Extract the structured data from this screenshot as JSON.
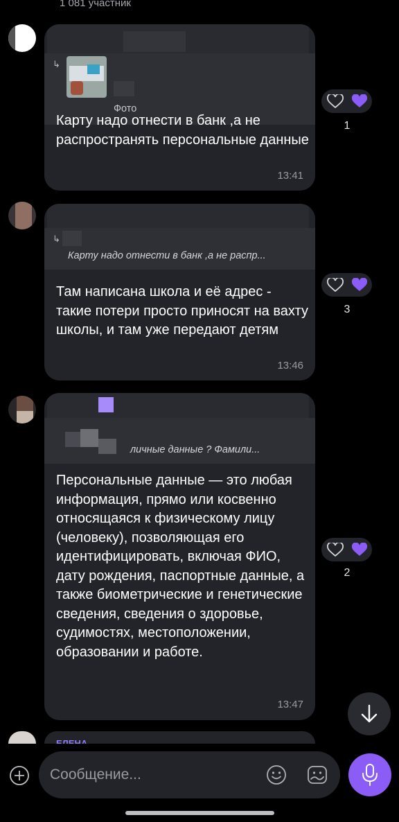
{
  "header": {
    "members": "1 081 участник"
  },
  "messages": [
    {
      "quote": {
        "label": "Фото"
      },
      "text": "Карту надо отнести в банк ,а не распространять персональные данные",
      "time": "13:41",
      "reactions": {
        "count": "1"
      }
    },
    {
      "quote": {
        "text": "Карту надо отнести в банк ,а не распр..."
      },
      "text": "Там написана школа и её адрес - такие потери просто приносят на вахту школы, и там уже передают детям",
      "time": "13:46",
      "reactions": {
        "count": "3"
      }
    },
    {
      "quote": {
        "text": "личные данные ? Фамили..."
      },
      "text": "Персональные данные — это любая информация, прямо или косвенно относящаяся к физическому лицу (человеку), позволяющая его идентифицировать, включая ФИО, дату рождения, паспортные данные, а также биометрические и генетические сведения, сведения о здоровье, судимостях, местоположении, образовании и работе.",
      "time": "13:47",
      "reactions": {
        "count": "2"
      }
    }
  ],
  "next_message": {
    "sender": "ЕЛЕНА"
  },
  "composer": {
    "placeholder": "Сообщение..."
  },
  "colors": {
    "accent": "#8b5cf6",
    "bubble": "#232429",
    "background": "#000000"
  },
  "icons": [
    "add-icon",
    "emoji-icon",
    "sticker-icon",
    "mic-icon",
    "arrow-down-icon",
    "heart-outline-icon",
    "heart-filled-icon",
    "reply-arrow-icon"
  ]
}
